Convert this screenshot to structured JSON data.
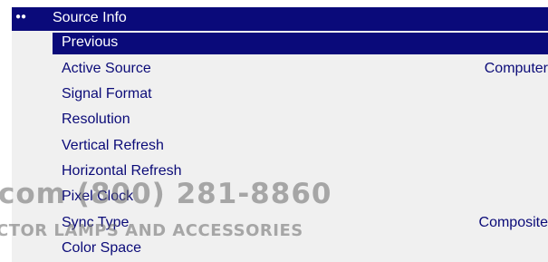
{
  "menu": {
    "title_dots": "●●",
    "title": "Source Info",
    "rows": [
      {
        "label": "Previous",
        "value": ""
      },
      {
        "label": "Active Source",
        "value": "Computer"
      },
      {
        "label": "Signal Format",
        "value": ""
      },
      {
        "label": "Resolution",
        "value": ""
      },
      {
        "label": "Vertical Refresh",
        "value": ""
      },
      {
        "label": "Horizontal Refresh",
        "value": ""
      },
      {
        "label": "Pixel Clock",
        "value": ""
      },
      {
        "label": "Sync Type",
        "value": "Composite"
      },
      {
        "label": "Color Space",
        "value": ""
      }
    ]
  },
  "watermark": {
    "line1": "com (800) 281-8860",
    "line2": "CTOR LAMPS AND ACCESSORIES"
  },
  "colors": {
    "selection": "#0a0a7a",
    "text": "#0b0b78",
    "background": "#f0f0f0"
  }
}
